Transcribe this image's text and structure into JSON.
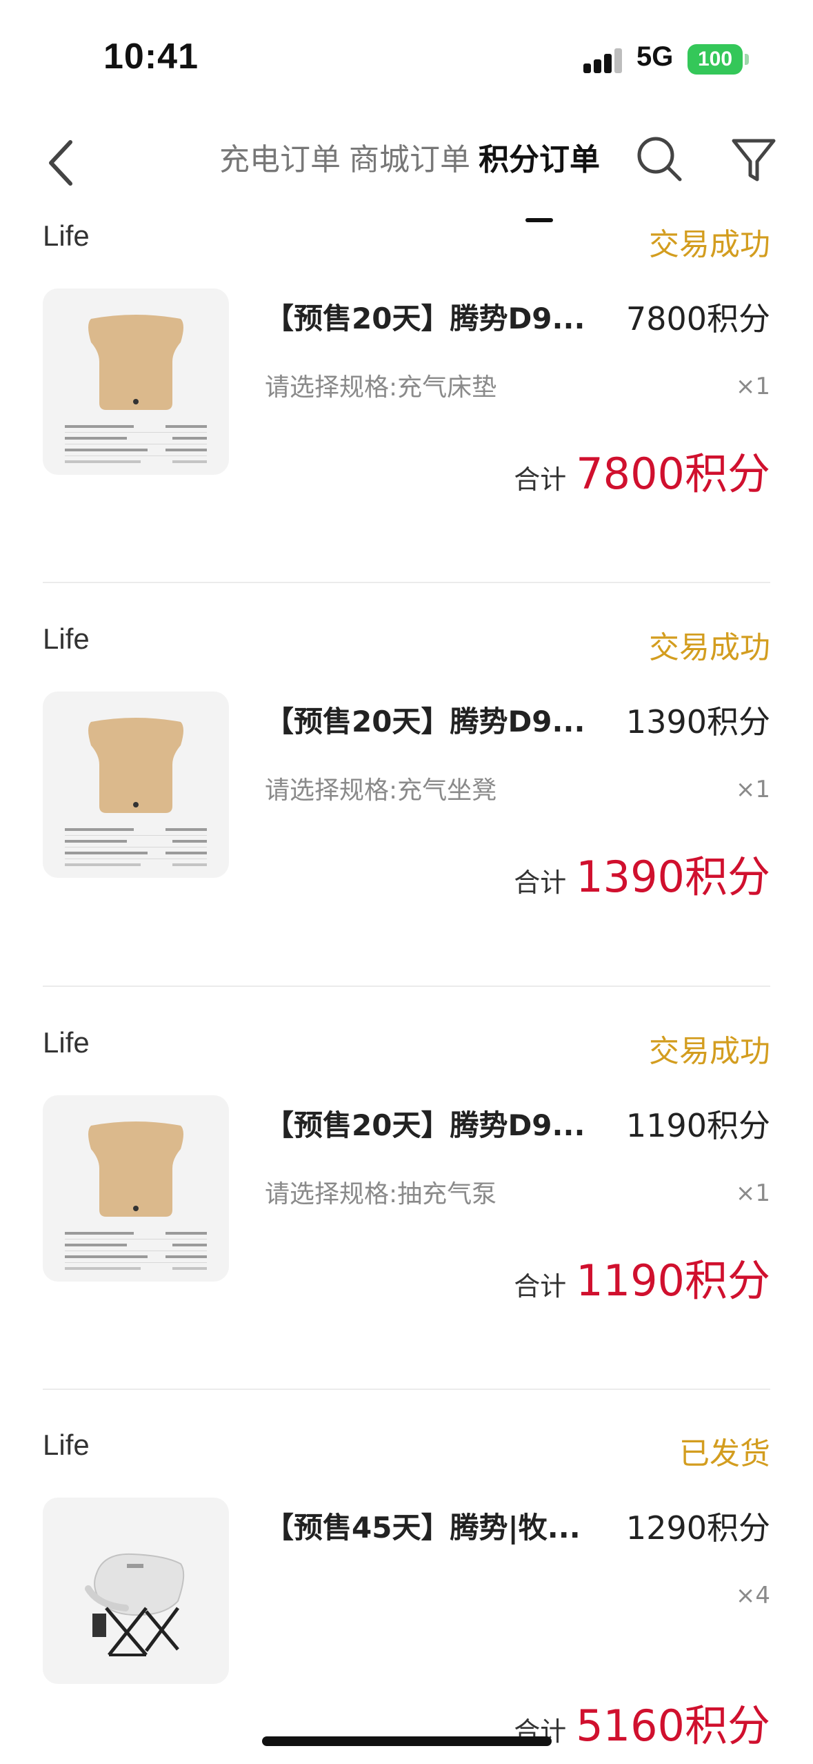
{
  "status_bar": {
    "time": "10:41",
    "network": "5G",
    "battery": "100"
  },
  "nav": {
    "tabs": [
      {
        "label": "充电订单",
        "active": false
      },
      {
        "label": "商城订单",
        "active": false
      },
      {
        "label": "积分订单",
        "active": true
      }
    ],
    "icons": {
      "back": "chevron-left-icon",
      "search": "search-icon",
      "filter": "filter-icon"
    }
  },
  "orders": [
    {
      "store": "Life",
      "status": "交易成功",
      "title": "【预售20天】腾势D9...",
      "price": "7800积分",
      "spec": "请选择规格:充气床垫",
      "qty": "×1",
      "total_label": "合计",
      "total": "7800积分",
      "thumb": "mattress-image"
    },
    {
      "store": "Life",
      "status": "交易成功",
      "title": "【预售20天】腾势D9...",
      "price": "1390积分",
      "spec": "请选择规格:充气坐凳",
      "qty": "×1",
      "total_label": "合计",
      "total": "1390积分",
      "thumb": "mattress-image"
    },
    {
      "store": "Life",
      "status": "交易成功",
      "title": "【预售20天】腾势D9...",
      "price": "1190积分",
      "spec": "请选择规格:抽充气泵",
      "qty": "×1",
      "total_label": "合计",
      "total": "1190积分",
      "thumb": "mattress-image"
    },
    {
      "store": "Life",
      "status": "已发货",
      "title": "【预售45天】腾势|牧...",
      "price": "1290积分",
      "spec": "",
      "qty": "×4",
      "total_label": "合计",
      "total": "5160积分",
      "thumb": "camping-chair-image"
    }
  ],
  "colors": {
    "status": "#d39d1f",
    "total": "#d0102e",
    "battery": "#34c759"
  }
}
